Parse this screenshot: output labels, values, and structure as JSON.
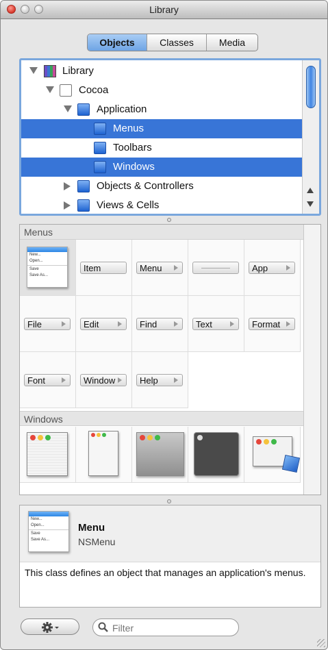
{
  "window": {
    "title": "Library"
  },
  "tabs": {
    "items": [
      {
        "label": "Objects",
        "selected": true
      },
      {
        "label": "Classes"
      },
      {
        "label": "Media"
      }
    ]
  },
  "tree": {
    "root": "Library",
    "cocoa": "Cocoa",
    "application": "Application",
    "menus": "Menus",
    "toolbars": "Toolbars",
    "windows": "Windows",
    "objects_controllers": "Objects & Controllers",
    "views_cells": "Views & Cells"
  },
  "palette": {
    "menus_header": "Menus",
    "menu_items": [
      "Item",
      "Menu",
      "",
      "App",
      "File",
      "Edit",
      "Find",
      "Text",
      "Format",
      "Font",
      "Window",
      "Help"
    ],
    "menu_thumb_lines": [
      "New...",
      "Open...",
      "Save",
      "Save As..."
    ],
    "windows_header": "Windows"
  },
  "info": {
    "name": "Menu",
    "class_name": "NSMenu",
    "description": "This class defines an object that manages an application's menus."
  },
  "footer": {
    "filter_placeholder": "Filter"
  },
  "icons": {
    "gear": "gear-icon",
    "search": "search-icon",
    "selection_color": "#3875d7"
  }
}
